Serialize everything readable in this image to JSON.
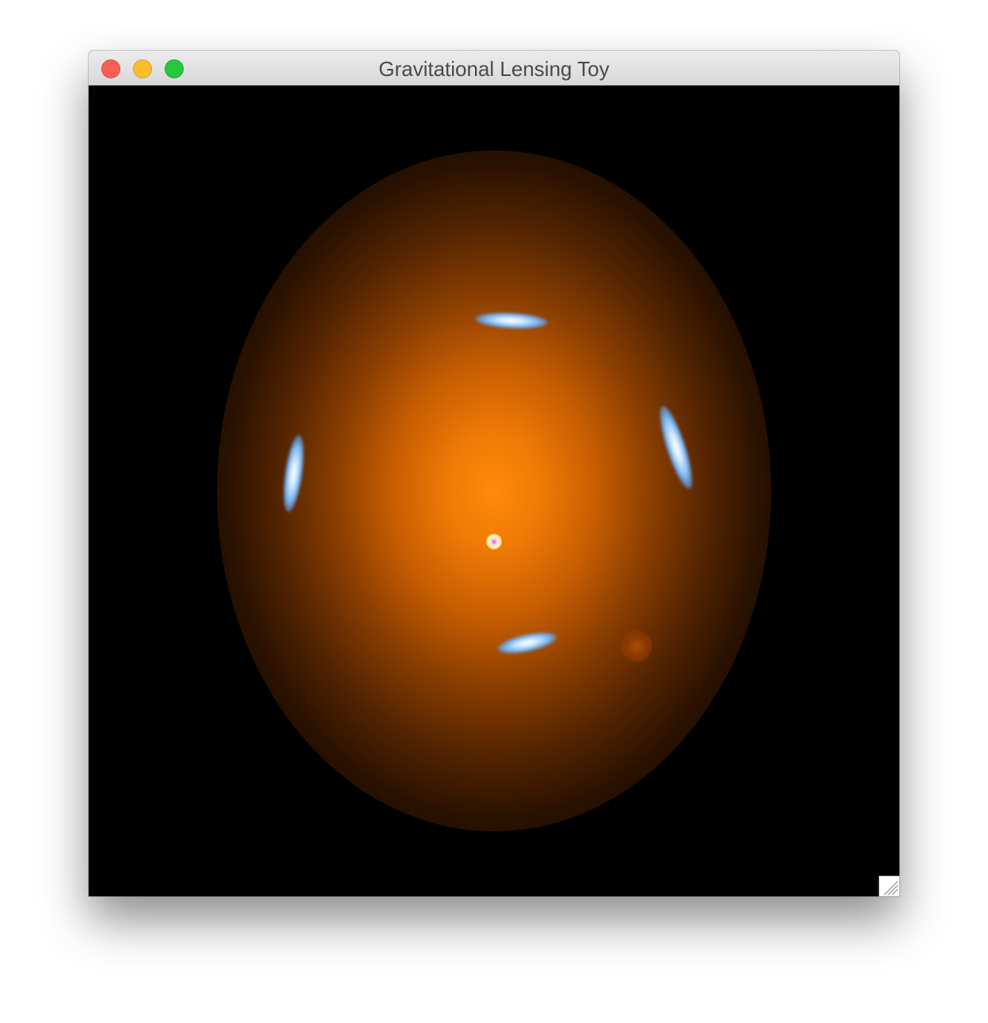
{
  "window": {
    "title": "Gravitational Lensing Toy",
    "controls": {
      "close": "close-icon",
      "minimize": "minimize-icon",
      "maximize": "maximize-icon"
    }
  },
  "scene": {
    "background_color": "#000000",
    "lens_glow_color": "#ff8a0a",
    "arc_color": "#7fbaf2",
    "blob_color": "#b04d05"
  }
}
